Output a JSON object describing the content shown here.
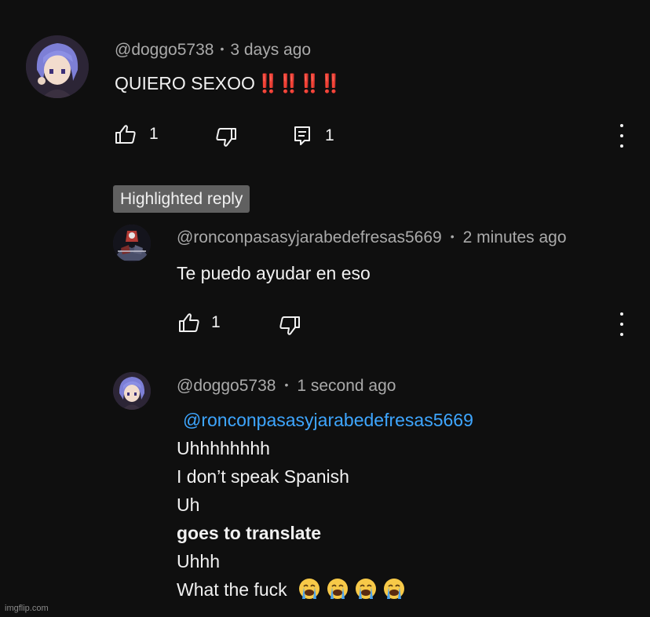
{
  "comment1": {
    "author": "@doggo5738",
    "time": "3 days ago",
    "text": "QUIERO SEXOO",
    "emphasis": "‼️‼️‼️‼️",
    "likes": "1",
    "replies": "1"
  },
  "highlight_badge": "Highlighted reply",
  "reply1": {
    "author": "@ronconpasasyjarabedefresas5669",
    "time": "2 minutes ago",
    "text": "Te puedo ayudar en eso",
    "likes": "1"
  },
  "reply2": {
    "author": "@doggo5738",
    "time": "1 second ago",
    "mention": "@ronconpasasyjarabedefresas5669",
    "lines": [
      "Uhhhhhhhh",
      "I don’t speak Spanish",
      "Uh",
      "goes to translate",
      "Uhhh",
      "What the fuck"
    ],
    "emojis": [
      "loudly-crying-face",
      "loudly-crying-face",
      "loudly-crying-face",
      "loudly-crying-face"
    ]
  },
  "watermark": "imgflip.com",
  "colors": {
    "background": "#0f0f0f",
    "mention": "#3ea6ff",
    "badge": "#606060",
    "meta": "#aaaaaa"
  }
}
